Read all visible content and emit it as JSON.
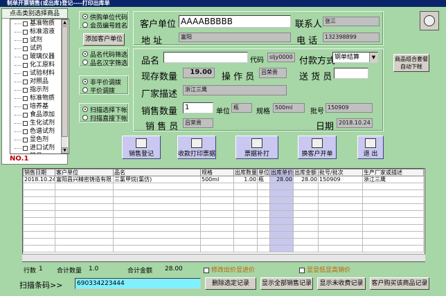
{
  "title": "制单开票销售(或出库)登记----打印出库单",
  "left_panel": {
    "header": "点击类别选择商品",
    "items": [
      "基准物质",
      "标准溶液",
      "试剂",
      "试药",
      "玻璃仪器",
      "化工原料",
      "试验材料",
      "对照品",
      "指示剂",
      "标准物质",
      "培养基",
      "食品添加",
      "生化试剂",
      "色谱试剂",
      "显色剂",
      "进口试剂",
      "器具"
    ],
    "no_label": "NO.1"
  },
  "options": {
    "group1": [
      "供购单位代码",
      "会员编号姓名"
    ],
    "add_customer": "添加客户单位",
    "group2": [
      "品名代码筛选",
      "品名汉字筛选"
    ],
    "group3": [
      "非平价调拨",
      "平价调拨"
    ],
    "group4": [
      "扫描选择下帐",
      "扫描直接下帐"
    ]
  },
  "customer": {
    "unit_label": "客户单位",
    "unit_value": "AAAABBBBB",
    "contact_label": "联系人",
    "contact_value": "张三",
    "address_label": "地  址",
    "address_value": "富阳",
    "phone_label": "电  话",
    "phone_value": "132398899"
  },
  "product": {
    "name_label": "品名",
    "name_value": "",
    "code_label": "代码",
    "code_value": "sljy0000",
    "pay_label": "付款方式",
    "pay_value": "钢单结算",
    "stock_label": "现存数量",
    "stock_value": "19.00",
    "operator_label": "操 作 员",
    "operator_value": "吕荣贵",
    "delivery_label": "送 货 员",
    "delivery_value": "",
    "maker_label": "厂家描述",
    "maker_value": "浙江三鹰",
    "qty_label": "销售数量",
    "qty_value": "1",
    "unit_label": "单位",
    "unit_value": "瓶",
    "spec_label": "规格",
    "spec_value": "500ml",
    "batch_label": "批号",
    "batch_value": "150909",
    "seller_label": "销 售 员",
    "seller_value": "吕荣贵",
    "date_label": "日期",
    "date_value": "2018.10.24"
  },
  "side_button": "商品组合套餐自动下帐",
  "actions": [
    "销售登记",
    "收款打印票据",
    "票据补打",
    "换客户开单",
    "退 出"
  ],
  "table": {
    "headers": [
      "销售日期",
      "客户单位",
      "品名",
      "规格",
      "出库数量",
      "单位",
      "出库单价",
      "出库金额",
      "批号/批次",
      "生产厂家或描述"
    ],
    "rows": [
      [
        "2018.10.24",
        "富阳昌兴精密铸造有限",
        "三氯甲烷(氯仿)",
        "500ml",
        "1.00",
        "瓶",
        "28.00",
        "28.00",
        "150909",
        "浙江三鹰"
      ]
    ]
  },
  "footer": {
    "rows_label": "行数",
    "rows_value": "1",
    "total_qty_label": "合计数量",
    "total_qty_value": "1.0",
    "total_amt_label": "合计金额",
    "total_amt_value": "28.00",
    "check1": "修改出价显进价",
    "check2": "显显低显高销价"
  },
  "bottom": {
    "scan_label": "扫描条码>>",
    "scan_value": "690334223444",
    "buttons": [
      "删除选定记录",
      "显示全部销售记录",
      "显示未收费记录",
      "客户购买该商品记录"
    ]
  }
}
